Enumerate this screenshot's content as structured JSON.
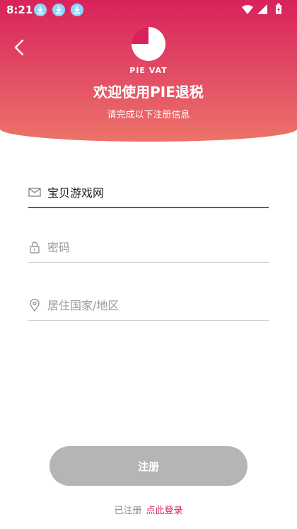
{
  "status_bar": {
    "time": "8:21"
  },
  "header": {
    "brand": "PIE VAT",
    "title": "欢迎使用PIE退税",
    "subtitle": "请完成以下注册信息"
  },
  "form": {
    "email": {
      "value": "宝贝游戏网",
      "icon": "mail-icon"
    },
    "password": {
      "placeholder": "密码",
      "icon": "lock-icon"
    },
    "country": {
      "placeholder": "居住国家/地区",
      "icon": "location-pin-icon"
    }
  },
  "submit": {
    "label": "注册"
  },
  "footer": {
    "prompt": "已注册",
    "login_link": "点此登录"
  },
  "colors": {
    "accent": "#d8225a",
    "button_disabled": "#b5b5b5",
    "download_icon": "#8fd6ff"
  }
}
